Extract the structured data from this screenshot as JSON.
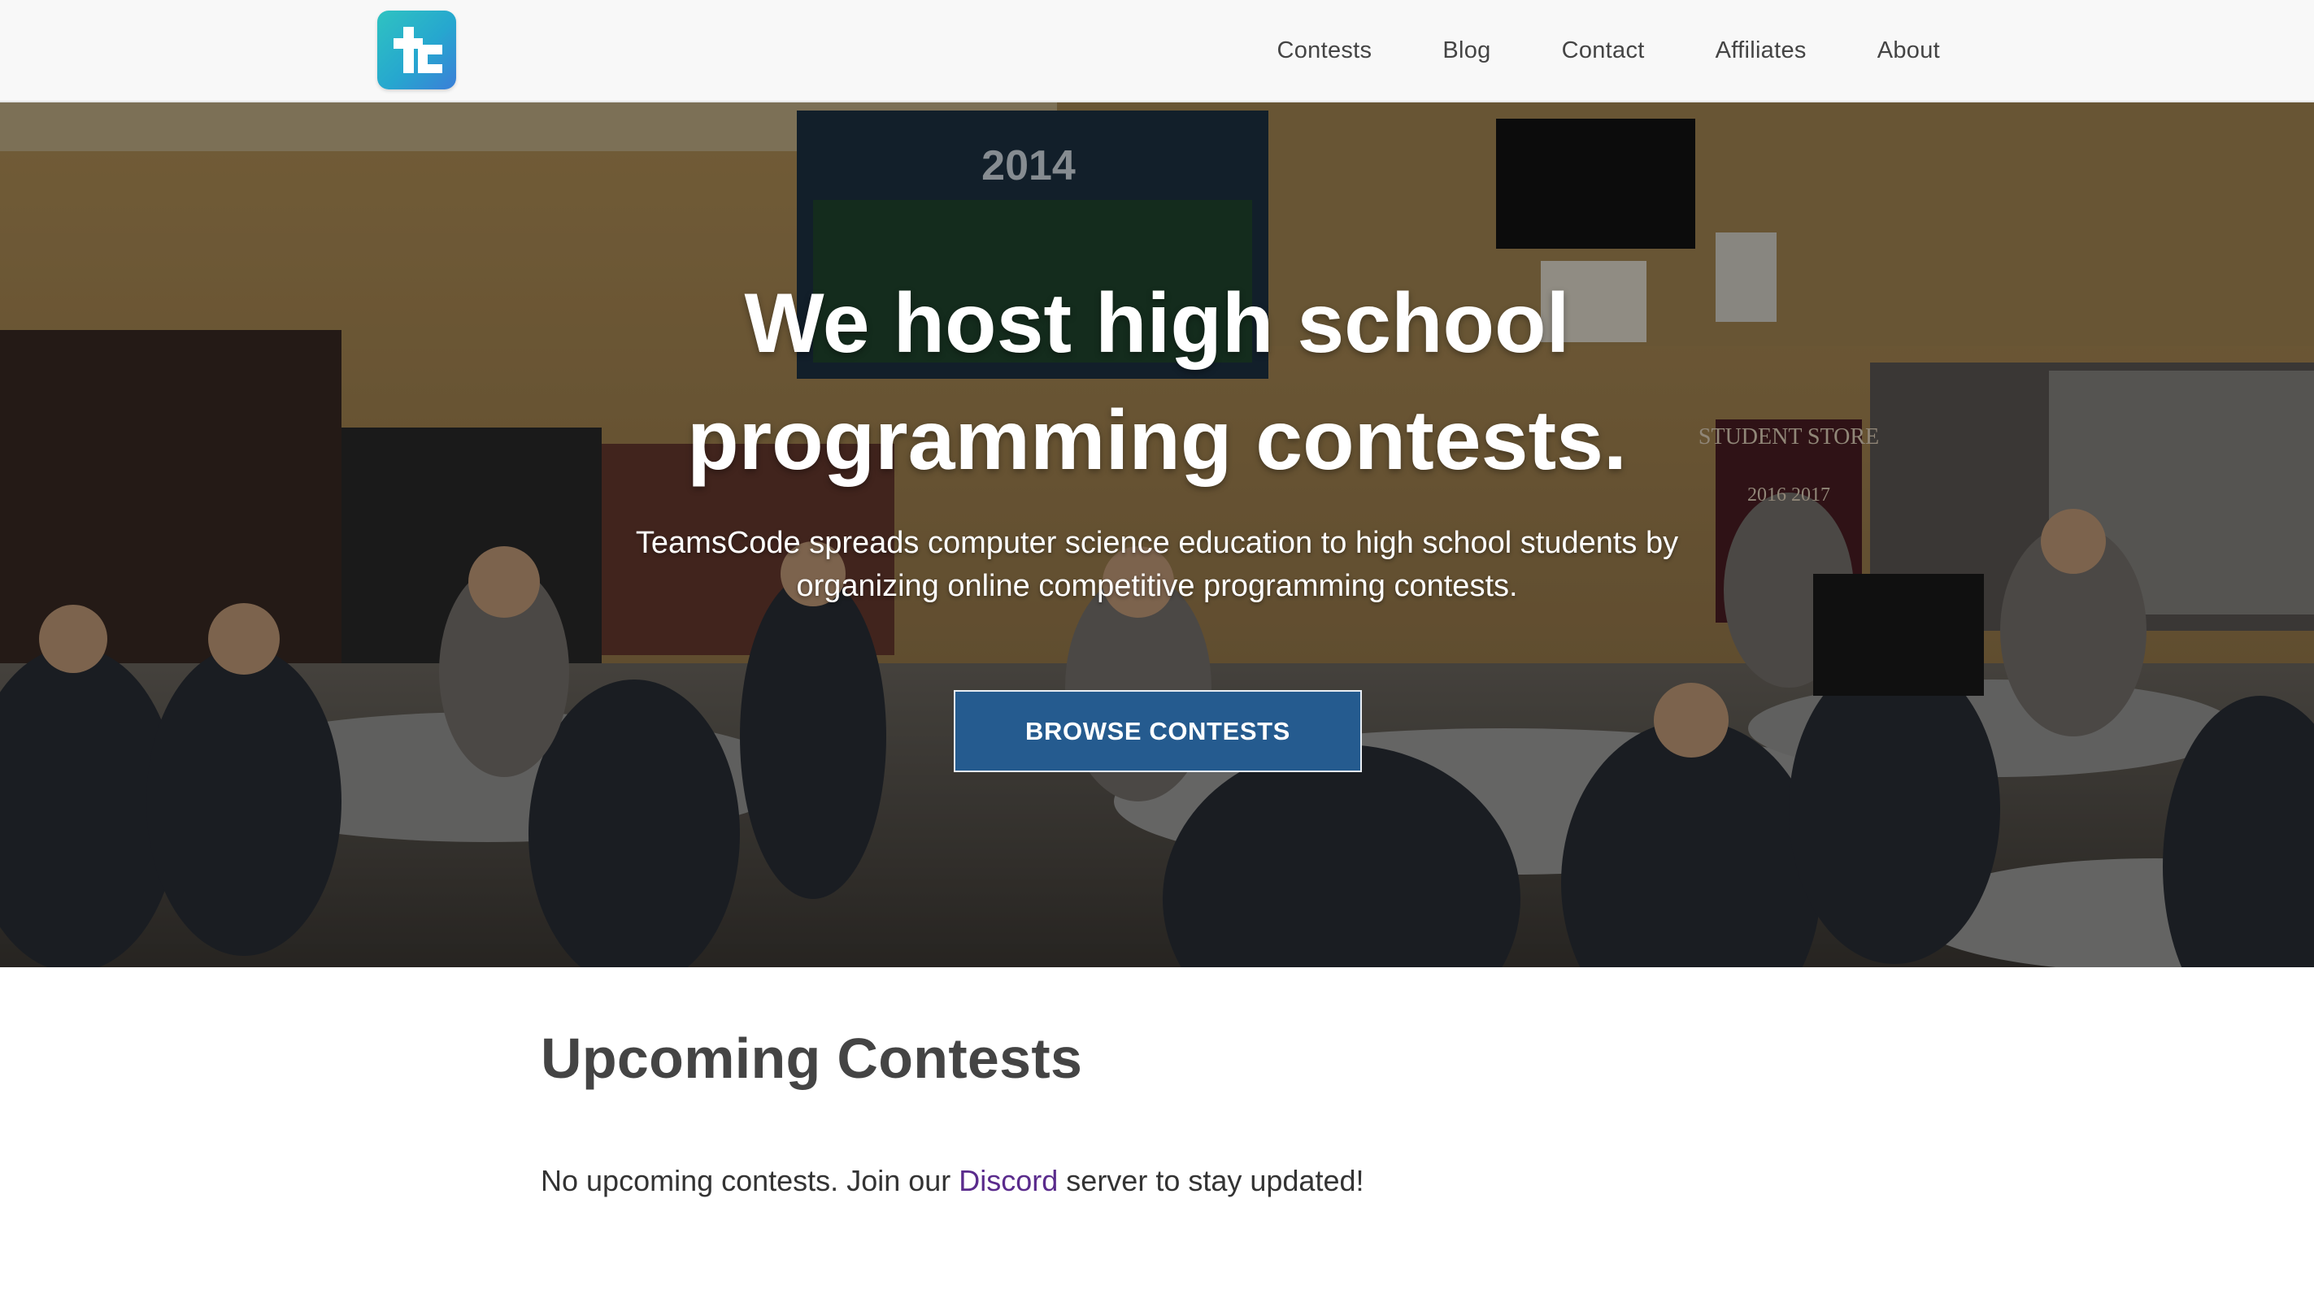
{
  "nav": {
    "logo_icon": "teamscode-logo-icon",
    "links": [
      {
        "label": "Contests"
      },
      {
        "label": "Blog"
      },
      {
        "label": "Contact"
      },
      {
        "label": "Affiliates"
      },
      {
        "label": "About"
      }
    ]
  },
  "hero": {
    "title_line1": "We host high school",
    "title_line2": "programming contests.",
    "subtitle_line1": "TeamsCode spreads computer science education to high school students by",
    "subtitle_line2": "organizing online competitive programming contests.",
    "cta_label": "BROWSE CONTESTS",
    "cta_color": "#255b8f",
    "background_image": "classroom-photo",
    "banner_year": "2014",
    "store_sign": "STUDENT STORE",
    "store_years": "2016 2017"
  },
  "upcoming": {
    "heading": "Upcoming Contests",
    "message_before": "No upcoming contests. Join our ",
    "discord_link": "Discord",
    "message_after": " server to stay updated!",
    "link_color": "#5a2b8c"
  }
}
